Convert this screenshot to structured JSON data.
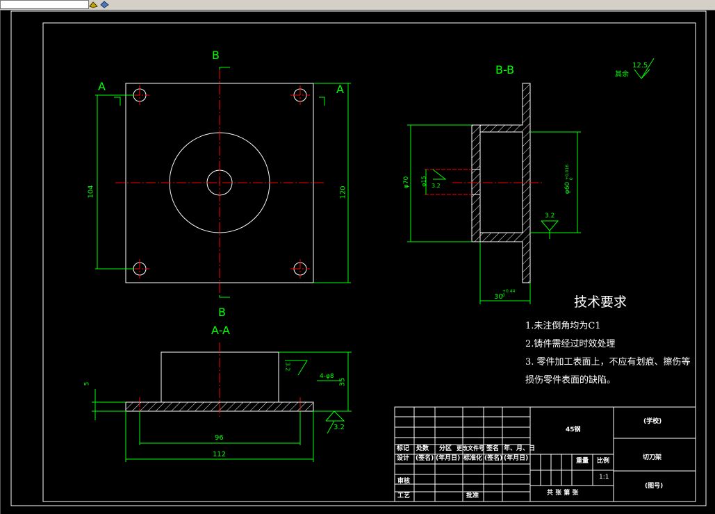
{
  "section_labels": {
    "B_top": "B",
    "B_bottom": "B",
    "A_left": "A",
    "A_right": "A",
    "BB": "B-B",
    "AA": "A-A"
  },
  "dimensions": {
    "d104": "104",
    "d120": "120",
    "d96": "96",
    "d112": "112",
    "d5": "5",
    "d35": "35",
    "hole": "4-φ8",
    "phi70": "φ70",
    "phi15": "φ15",
    "phi60": "φ60",
    "tol60": "+0.016\n0",
    "d30": "30",
    "tol30": "+0.44\n0"
  },
  "roughness": {
    "rest_label": "其余",
    "rest_value": "12.5",
    "r32a": "3.2",
    "r32b": "3.2",
    "r32c": "3.2",
    "r32d": "3.2"
  },
  "tech_req": {
    "title": "技术要求",
    "lines": [
      "1.未注倒角均为C1",
      "2.铸件需经过时效处理",
      "3. 零件加工表面上，不应有划痕、擦伤等",
      "损伤零件表面的缺陷。"
    ]
  },
  "title_block": {
    "material": "45钢",
    "school": "(学校)",
    "part_name": "切刀架",
    "drawing_no": "(图号)",
    "row1": [
      "标记",
      "处数",
      "分区",
      "更改文件号",
      "签名",
      "年、月、日"
    ],
    "row2": [
      "设计",
      "(签名)",
      "(年月日)",
      "标准化",
      "(签名)",
      "(年月日)"
    ],
    "review": "审核",
    "process": "工艺",
    "approve": "批准",
    "weight": "重量",
    "scale_label": "比例",
    "scale": "1:1",
    "sheets": "共  张  第  张"
  },
  "colors": {
    "line": "#ffffff",
    "dim": "#00ff00",
    "center": "#ff0000",
    "bg": "#000000"
  }
}
